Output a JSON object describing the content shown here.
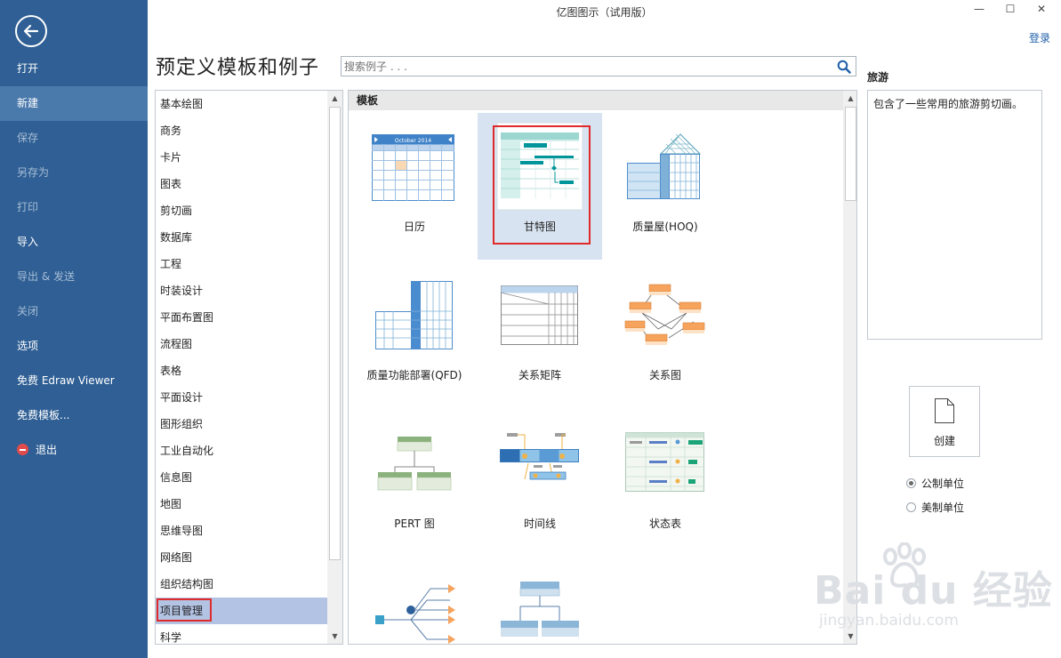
{
  "window": {
    "title": "亿图图示（试用版）",
    "login": "登录",
    "minimize": "—",
    "maximize": "☐",
    "close": "✕"
  },
  "nav": {
    "items": [
      {
        "label": "打开"
      },
      {
        "label": "新建"
      },
      {
        "label": "保存"
      },
      {
        "label": "另存为"
      },
      {
        "label": "打印"
      },
      {
        "label": "导入"
      },
      {
        "label": "导出 & 发送"
      },
      {
        "label": "关闭"
      },
      {
        "label": "选项"
      },
      {
        "label": "免费 Edraw Viewer"
      },
      {
        "label": "免费模板..."
      },
      {
        "label": "退出"
      }
    ]
  },
  "page": {
    "title": "预定义模板和例子"
  },
  "search": {
    "placeholder": "搜索例子 . . ."
  },
  "categories": [
    "基本绘图",
    "商务",
    "卡片",
    "图表",
    "剪切画",
    "数据库",
    "工程",
    "时装设计",
    "平面布置图",
    "流程图",
    "表格",
    "平面设计",
    "图形组织",
    "工业自动化",
    "信息图",
    "地图",
    "思维导图",
    "网络图",
    "组织结构图",
    "项目管理",
    "科学"
  ],
  "templates": {
    "header": "模板",
    "items": [
      {
        "label": "日历",
        "calendar_month": "October 2014"
      },
      {
        "label": "甘特图"
      },
      {
        "label": "质量屋(HOQ)"
      },
      {
        "label": "质量功能部署(QFD)"
      },
      {
        "label": "关系矩阵"
      },
      {
        "label": "关系图"
      },
      {
        "label": "PERT 图"
      },
      {
        "label": "时间线"
      },
      {
        "label": "状态表"
      },
      {
        "label": ""
      },
      {
        "label": ""
      }
    ]
  },
  "right": {
    "title": "旅游",
    "description": "包含了一些常用的旅游剪切画。",
    "create_label": "创建",
    "units": [
      {
        "label": "公制单位",
        "checked": true
      },
      {
        "label": "美制单位",
        "checked": false
      }
    ]
  },
  "watermark": {
    "brand": "Bai  du 经验",
    "url": "jingyan.baidu.com"
  },
  "colors": {
    "nav_bg": "#2f5f94",
    "nav_active": "#4a79ac",
    "selection": "#b3c3e4",
    "highlight_box": "#e02a2a"
  }
}
